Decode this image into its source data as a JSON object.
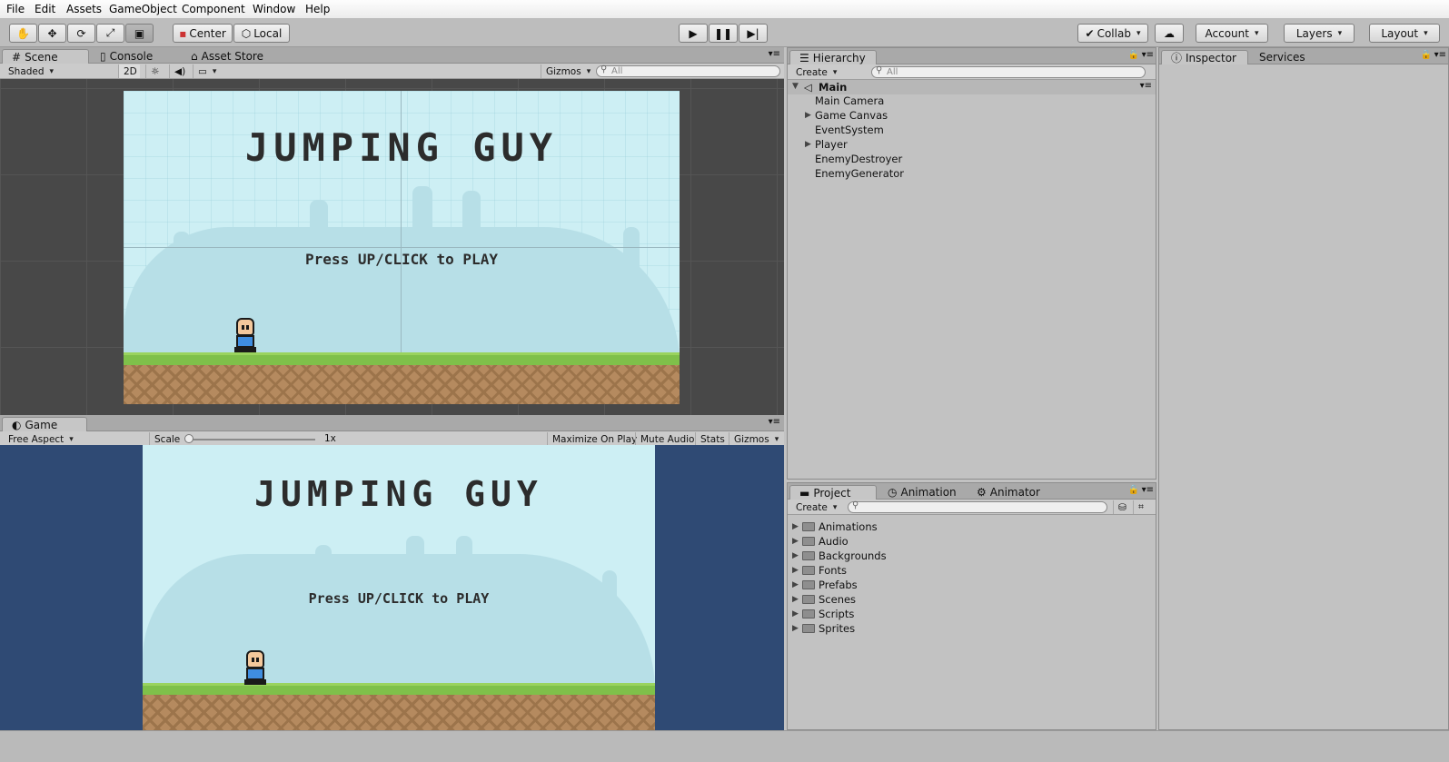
{
  "menu": [
    "File",
    "Edit",
    "Assets",
    "GameObject",
    "Component",
    "Window",
    "Help"
  ],
  "toolbar": {
    "pivot_label": "Center",
    "space_label": "Local",
    "collab_label": "Collab",
    "account_label": "Account",
    "layers_label": "Layers",
    "layout_label": "Layout",
    "transform_tools": [
      "hand-icon",
      "move-icon",
      "rotate-icon",
      "scale-icon",
      "rect-icon"
    ]
  },
  "scene_panel": {
    "tabs": [
      "Scene",
      "Console",
      "Asset Store"
    ],
    "shading_mode": "Shaded",
    "mode_2d": "2D",
    "gizmos_label": "Gizmos",
    "search_placeholder": "All"
  },
  "game_panel": {
    "tab": "Game",
    "aspect": "Free Aspect",
    "scale_label": "Scale",
    "scale_value": "1x",
    "maximize_label": "Maximize On Play",
    "mute_label": "Mute Audio",
    "stats_label": "Stats",
    "gizmos_label": "Gizmos"
  },
  "game_screen": {
    "title": "JUMPING GUY",
    "prompt": "Press UP/CLICK to PLAY"
  },
  "hierarchy": {
    "tab": "Hierarchy",
    "create_label": "Create",
    "search_placeholder": "All",
    "scene_name": "Main",
    "items": [
      "Main Camera",
      "Game Canvas",
      "EventSystem",
      "Player",
      "EnemyDestroyer",
      "EnemyGenerator"
    ]
  },
  "inspector": {
    "tabs": [
      "Inspector",
      "Services"
    ]
  },
  "project": {
    "tabs": [
      "Project",
      "Animation",
      "Animator"
    ],
    "create_label": "Create",
    "folders": [
      "Animations",
      "Audio",
      "Backgrounds",
      "Fonts",
      "Prefabs",
      "Scenes",
      "Scripts",
      "Sprites"
    ]
  },
  "colors": {
    "sky": "#cdeff4",
    "grass": "#7fc04a",
    "dirt": "#b58a5f",
    "game_letterbox": "#2f4a74",
    "scene_bg": "#484848"
  }
}
